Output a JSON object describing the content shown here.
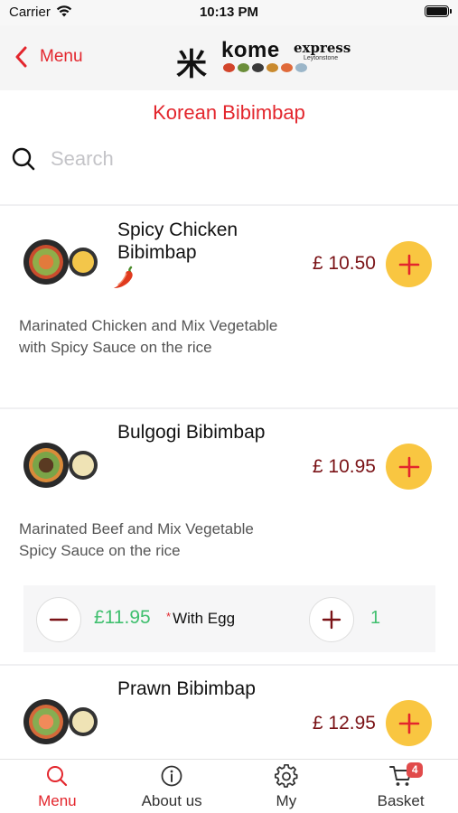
{
  "status_bar": {
    "carrier": "Carrier",
    "time": "10:13 PM"
  },
  "nav": {
    "back_label": "Menu",
    "logo": {
      "kanji": "米",
      "brand": "kome",
      "express": "express",
      "location": "Leytonstone"
    }
  },
  "category_title": "Korean Bibimbap",
  "search": {
    "placeholder": "Search",
    "value": ""
  },
  "items": [
    {
      "name_line1": "Spicy Chicken",
      "name_line2": "Bibimbap",
      "price": "£ 10.50",
      "spicy": true,
      "description": "Marinated Chicken and Mix Vegetable with Spicy Sauce on the rice"
    },
    {
      "name_line1": "Bulgogi Bibimbap",
      "price": "£ 10.95",
      "spicy": false,
      "description": "Marinated Beef and Mix Vegetable Spicy Sauce on the rice",
      "option": {
        "price": "£11.95",
        "star": "*",
        "label": "With Egg",
        "quantity": "1"
      }
    },
    {
      "name_line1": "Prawn Bibimbap",
      "price": "£ 12.95",
      "spicy": false
    }
  ],
  "tabs": [
    {
      "label": "Menu",
      "icon": "search-icon",
      "active": true
    },
    {
      "label": "About us",
      "icon": "info-icon",
      "active": false
    },
    {
      "label": "My",
      "icon": "gear-icon",
      "active": false
    },
    {
      "label": "Basket",
      "icon": "cart-icon",
      "active": false,
      "badge": "4"
    }
  ],
  "colors": {
    "accent_red": "#e3262d",
    "price_red": "#7a1216",
    "add_button_yellow": "#f9c641",
    "option_green": "#3fbf6e"
  }
}
